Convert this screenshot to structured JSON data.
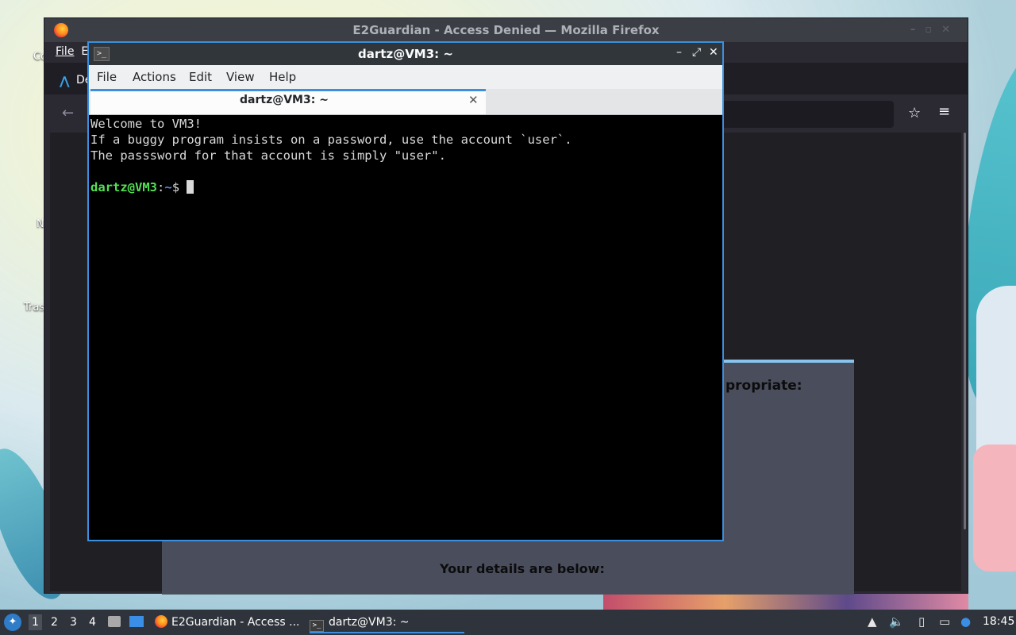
{
  "desktop": {
    "icons": [
      {
        "label": "Co"
      },
      {
        "label": "Na"
      },
      {
        "label": "Trash"
      }
    ]
  },
  "firefox": {
    "title": "E2Guardian - Access Denied — Mozilla Firefox",
    "menu_file": "File",
    "menu_edit_partial": "E",
    "tab_label": "De",
    "page_text_partial": "propriate:",
    "details_heading": "Your details are below:"
  },
  "terminal": {
    "title": "dartz@VM3: ~",
    "menus": [
      "File",
      "Actions",
      "Edit",
      "View",
      "Help"
    ],
    "tab_label": "dartz@VM3: ~",
    "lines": [
      "Welcome to VM3!",
      "If a buggy program insists on a password, use the account `user`.",
      "The passsword for that account is simply \"user\"."
    ],
    "prompt_user": "dartz@VM3",
    "prompt_sep": ":",
    "prompt_path": "~",
    "prompt_symbol": "$ "
  },
  "taskbar": {
    "workspaces": [
      "1",
      "2",
      "3",
      "4"
    ],
    "active_workspace": "1",
    "tasks": [
      {
        "label": "E2Guardian - Access ..."
      },
      {
        "label": "dartz@VM3: ~"
      }
    ],
    "clock": "18:45"
  },
  "colors": {
    "accent": "#3c8fde",
    "prompt_user": "#54e054",
    "prompt_path": "#4f8fe0"
  }
}
